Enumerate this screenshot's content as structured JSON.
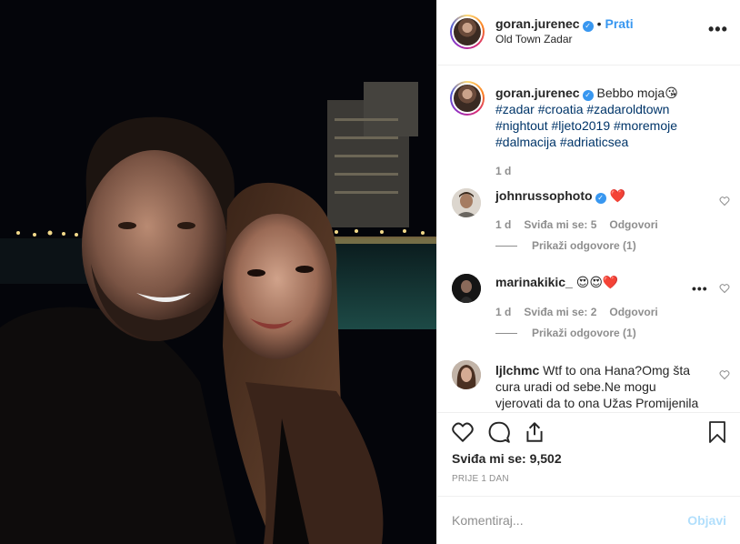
{
  "post": {
    "username": "goran.jurenec",
    "verified_mark": "✓",
    "dot": "•",
    "follow_label": "Prati",
    "location": "Old Town Zadar",
    "more_icon": "•••"
  },
  "caption": {
    "username": "goran.jurenec",
    "text": "Bebbo moja😘",
    "hashtags_line1": "#zadar #croatia #zadaroldtown",
    "hashtags_line2": "#nightout #ljeto2019 #moremoje",
    "hashtags_line3": "#dalmacija #adriaticsea",
    "time": "1 d"
  },
  "comments": [
    {
      "username": "johnrussophoto",
      "verified": true,
      "text": "❤️",
      "time": "1 d",
      "likes": "Sviđa mi se: 5",
      "reply": "Odgovori",
      "view_replies": "Prikaži odgovore (1)"
    },
    {
      "username": "marinakikic_",
      "text": "😍😍❤️",
      "time": "1 d",
      "likes": "Sviđa mi se: 2",
      "reply": "Odgovori",
      "view_replies": "Prikaži odgovore (1)",
      "more_icon": "•••"
    },
    {
      "username": "ljlchmc",
      "text_line1": "Wtf to ona Hana?Omg šta",
      "text_line2": "cura uradi od sebe.Ne mogu",
      "text_line3": "vjerovati da to ona Užas Promijenila"
    }
  ],
  "actions": {
    "likes": "Sviđa mi se: 9,502",
    "date": "PRIJE 1 DAN"
  },
  "composer": {
    "placeholder": "Komentiraj...",
    "post_label": "Objavi"
  },
  "colors": {
    "link": "#3897f0",
    "hashtag": "#003569",
    "muted": "#8e8e8e",
    "heart": "#ed4956"
  }
}
